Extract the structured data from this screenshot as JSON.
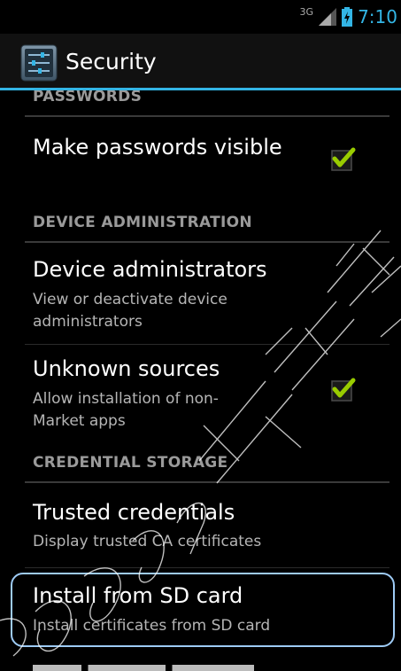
{
  "status_bar": {
    "network_type": "3G",
    "time": "7:10"
  },
  "action_bar": {
    "title": "Security",
    "icon": "settings-sliders-icon"
  },
  "sections": {
    "passwords": {
      "header": "PASSWORDS",
      "make_visible": {
        "title": "Make passwords visible",
        "checked": true
      }
    },
    "device_admin": {
      "header": "DEVICE ADMINISTRATION",
      "admins": {
        "title": "Device administrators",
        "summary": "View or deactivate device administrators"
      },
      "unknown_sources": {
        "title": "Unknown sources",
        "summary": "Allow installation of non-Market apps",
        "checked": true
      }
    },
    "credential_storage": {
      "header": "CREDENTIAL STORAGE",
      "trusted": {
        "title": "Trusted credentials",
        "summary": "Display trusted CA certificates"
      },
      "install_sd": {
        "title": "Install from SD card",
        "summary": "Install certificates from SD card"
      }
    }
  },
  "colors": {
    "accent": "#33b5e5",
    "check": "#99cc00",
    "highlight_border": "#9ecbf5"
  }
}
